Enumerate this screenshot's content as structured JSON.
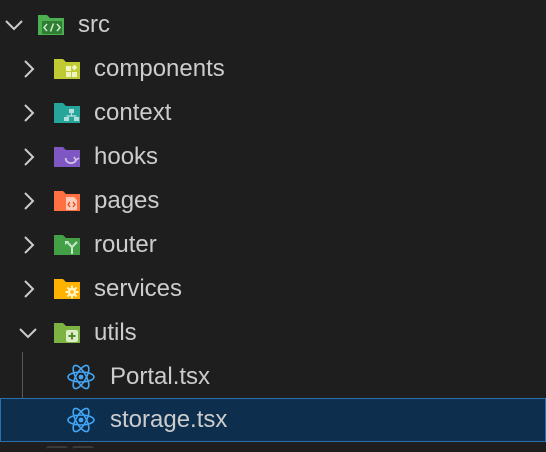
{
  "explorer": {
    "items": [
      {
        "label": "src",
        "kind": "folder",
        "expanded": true,
        "icon": "folder-src-icon",
        "color": "#4caf50"
      },
      {
        "label": "components",
        "kind": "folder",
        "expanded": false,
        "icon": "folder-components-icon",
        "color": "#c0ca33"
      },
      {
        "label": "context",
        "kind": "folder",
        "expanded": false,
        "icon": "folder-context-icon",
        "color": "#26a69a"
      },
      {
        "label": "hooks",
        "kind": "folder",
        "expanded": false,
        "icon": "folder-hooks-icon",
        "color": "#7e57c2"
      },
      {
        "label": "pages",
        "kind": "folder",
        "expanded": false,
        "icon": "folder-pages-icon",
        "color": "#ff7043"
      },
      {
        "label": "router",
        "kind": "folder",
        "expanded": false,
        "icon": "folder-router-icon",
        "color": "#43a047"
      },
      {
        "label": "services",
        "kind": "folder",
        "expanded": false,
        "icon": "folder-services-icon",
        "color": "#ffb300"
      },
      {
        "label": "utils",
        "kind": "folder",
        "expanded": true,
        "icon": "folder-utils-icon",
        "color": "#7cb342"
      },
      {
        "label": "Portal.tsx",
        "kind": "file",
        "icon": "react-icon",
        "color": "#42a5f5"
      },
      {
        "label": "storage.tsx",
        "kind": "file",
        "icon": "react-icon",
        "color": "#42a5f5",
        "selected": true
      }
    ]
  },
  "colors": {
    "background": "#1e1e1e",
    "selection": "#0d2e4d",
    "selection_border": "#2a6fb0",
    "text": "#cccccc",
    "chevron": "#cccccc"
  }
}
